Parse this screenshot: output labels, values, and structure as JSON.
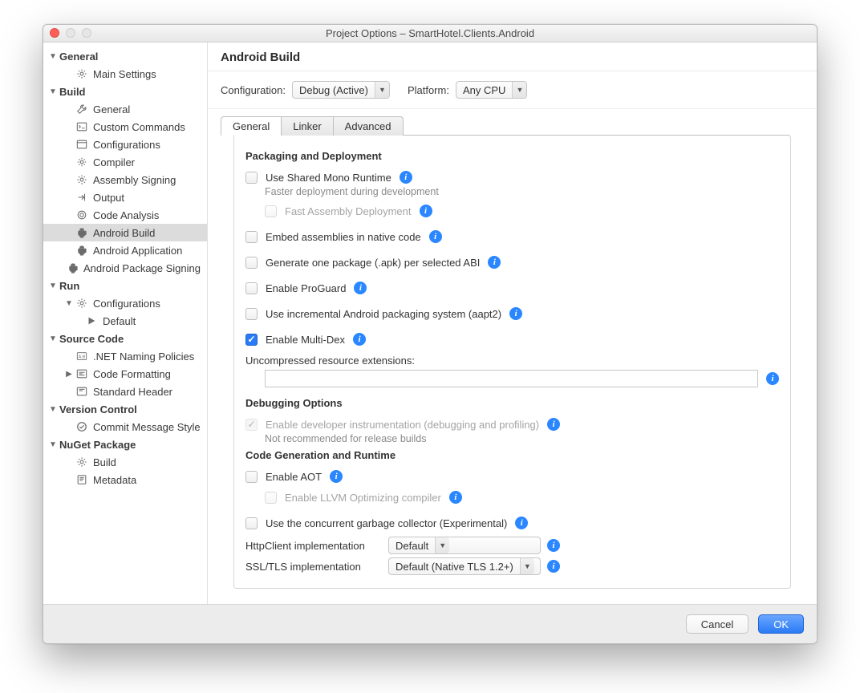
{
  "window": {
    "title": "Project Options – SmartHotel.Clients.Android"
  },
  "sidebar": [
    {
      "label": "General",
      "type": "group",
      "indent": 0,
      "disclosure": "down",
      "bold": true
    },
    {
      "label": "Main Settings",
      "type": "item",
      "icon": "gear",
      "indent": 1
    },
    {
      "label": "Build",
      "type": "group",
      "indent": 0,
      "disclosure": "down",
      "bold": true
    },
    {
      "label": "General",
      "type": "item",
      "icon": "wrench",
      "indent": 1
    },
    {
      "label": "Custom Commands",
      "type": "item",
      "icon": "terminal",
      "indent": 1
    },
    {
      "label": "Configurations",
      "type": "item",
      "icon": "window",
      "indent": 1
    },
    {
      "label": "Compiler",
      "type": "item",
      "icon": "cog",
      "indent": 1
    },
    {
      "label": "Assembly Signing",
      "type": "item",
      "icon": "gear",
      "indent": 1
    },
    {
      "label": "Output",
      "type": "item",
      "icon": "output",
      "indent": 1
    },
    {
      "label": "Code Analysis",
      "type": "item",
      "icon": "target",
      "indent": 1
    },
    {
      "label": "Android Build",
      "type": "item",
      "icon": "android",
      "indent": 1,
      "selected": true
    },
    {
      "label": "Android Application",
      "type": "item",
      "icon": "android",
      "indent": 1
    },
    {
      "label": "Android Package Signing",
      "type": "item",
      "icon": "android",
      "indent": 1
    },
    {
      "label": "Run",
      "type": "group",
      "indent": 0,
      "disclosure": "down",
      "bold": true
    },
    {
      "label": "Configurations",
      "type": "group",
      "icon": "gear",
      "indent": 1,
      "disclosure": "down"
    },
    {
      "label": "Default",
      "type": "item",
      "icon": "play",
      "indent": 2
    },
    {
      "label": "Source Code",
      "type": "group",
      "indent": 0,
      "disclosure": "down",
      "bold": true
    },
    {
      "label": ".NET Naming Policies",
      "type": "item",
      "icon": "abc",
      "indent": 1
    },
    {
      "label": "Code Formatting",
      "type": "group",
      "icon": "format",
      "indent": 1,
      "disclosure": "right"
    },
    {
      "label": "Standard Header",
      "type": "item",
      "icon": "header",
      "indent": 1
    },
    {
      "label": "Version Control",
      "type": "group",
      "indent": 0,
      "disclosure": "down",
      "bold": true
    },
    {
      "label": "Commit Message Style",
      "type": "item",
      "icon": "check",
      "indent": 1
    },
    {
      "label": "NuGet Package",
      "type": "group",
      "indent": 0,
      "disclosure": "down",
      "bold": true
    },
    {
      "label": "Build",
      "type": "item",
      "icon": "gear",
      "indent": 1
    },
    {
      "label": "Metadata",
      "type": "item",
      "icon": "meta",
      "indent": 1
    }
  ],
  "main": {
    "title": "Android Build",
    "config_label": "Configuration:",
    "config_value": "Debug (Active)",
    "platform_label": "Platform:",
    "platform_value": "Any CPU",
    "tabs": [
      "General",
      "Linker",
      "Advanced"
    ],
    "active_tab": 0,
    "sections": {
      "packaging": {
        "title": "Packaging and Deployment",
        "opts": [
          {
            "key": "use_shared_mono",
            "label": "Use Shared Mono Runtime",
            "checked": false,
            "info": true,
            "hint": "Faster deployment during development"
          },
          {
            "key": "fast_deploy",
            "label": "Fast Assembly Deployment",
            "checked": false,
            "info": true,
            "disabled": true,
            "sub": true
          },
          {
            "key": "embed_native",
            "label": "Embed assemblies in native code",
            "checked": false,
            "info": true,
            "spaced": true
          },
          {
            "key": "one_apk_per_abi",
            "label": "Generate one package (.apk) per selected ABI",
            "checked": false,
            "info": true,
            "spaced": true
          },
          {
            "key": "enable_proguard",
            "label": "Enable ProGuard",
            "checked": false,
            "info": true,
            "spaced": true
          },
          {
            "key": "aapt2",
            "label": "Use incremental Android packaging system (aapt2)",
            "checked": false,
            "info": true,
            "spaced": true
          },
          {
            "key": "multidex",
            "label": "Enable Multi-Dex",
            "checked": true,
            "info": true,
            "spaced": true
          }
        ],
        "uncompressed_label": "Uncompressed resource extensions:",
        "uncompressed_value": ""
      },
      "debugging": {
        "title": "Debugging Options",
        "opt": {
          "label": "Enable developer instrumentation (debugging and profiling)",
          "checked": true,
          "disabled": true,
          "info": true
        },
        "hint": "Not recommended for release builds"
      },
      "codegen": {
        "title": "Code Generation and Runtime",
        "opts": [
          {
            "key": "aot",
            "label": "Enable AOT",
            "checked": false,
            "info": true
          },
          {
            "key": "llvm",
            "label": "Enable LLVM Optimizing compiler",
            "checked": false,
            "info": true,
            "disabled": true,
            "sub": true
          },
          {
            "key": "concurrent_gc",
            "label": "Use the concurrent garbage collector (Experimental)",
            "checked": false,
            "info": true,
            "spaced": true
          }
        ],
        "httpclient_label": "HttpClient implementation",
        "httpclient_value": "Default",
        "ssltls_label": "SSL/TLS implementation",
        "ssltls_value": "Default (Native TLS 1.2+)"
      }
    }
  },
  "footer": {
    "cancel": "Cancel",
    "ok": "OK"
  }
}
